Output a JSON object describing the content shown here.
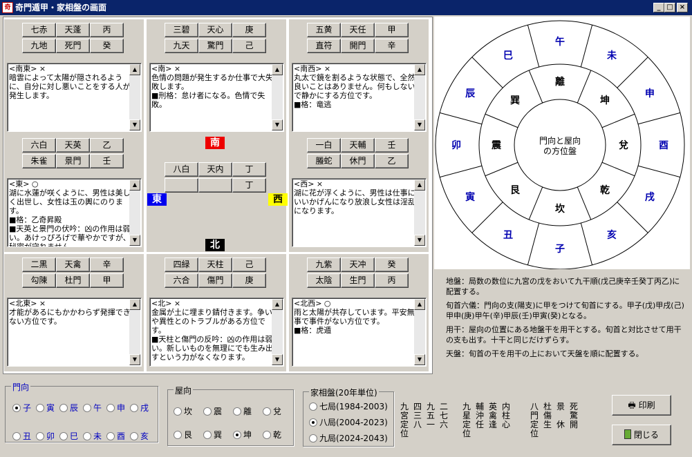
{
  "window": {
    "title": "奇門遁甲・家相盤の画面",
    "icon_text": "奇",
    "min": "_",
    "max": "□",
    "close": "×"
  },
  "cells": [
    {
      "id": "se",
      "r1": [
        "七赤",
        "天蓬",
        "丙"
      ],
      "r2": [
        "九地",
        "死門",
        "癸"
      ],
      "memo": "<南東> ×\n暗雲によって太陽が隠されるように、自分に対し悪いことをする人が発生します。"
    },
    {
      "id": "s",
      "r1": [
        "三碧",
        "天心",
        "庚"
      ],
      "r2": [
        "九天",
        "驚門",
        "己"
      ],
      "memo": "<南> ×\n色情の問題が発生するか仕事で大失敗します。\n■刑格：怠け者になる。色情で失敗。"
    },
    {
      "id": "sw",
      "r1": [
        "五黄",
        "天任",
        "甲"
      ],
      "r2": [
        "直符",
        "開門",
        "辛"
      ],
      "memo": "<南西> ×\n丸太で鏡を割るような状態で、全然良いことはありません。何もしないで静かにする方位です。\n■格：竜逃"
    },
    {
      "id": "e",
      "r1": [
        "六白",
        "天英",
        "乙"
      ],
      "r2": [
        "朱雀",
        "景門",
        "壬"
      ],
      "memo": "<東> ○\n湖に水蓮が咲くように、男性は美しく出世し、女性は玉の輿にのります。\n■格：乙奇昇殿\n■天英と景門の伏吟：凶の作用は弱い。あけっぴろげで華やかですが、秘密が守れません。"
    },
    {
      "id": "w",
      "r1": [
        "一白",
        "天輔",
        "壬"
      ],
      "r2": [
        "螣蛇",
        "休門",
        "乙"
      ],
      "memo": "<西> ×\n湖に花が浮くように、男性は仕事にいいかげんになり放浪し女性は淫乱になります。"
    },
    {
      "id": "ne",
      "r1": [
        "二黒",
        "天禽",
        "辛"
      ],
      "r2": [
        "勾陳",
        "杜門",
        "甲"
      ],
      "memo": "<北東> ×\n才能があるにもかかわらず発揮できない方位です。"
    },
    {
      "id": "n",
      "r1": [
        "四緑",
        "天柱",
        "己"
      ],
      "r2": [
        "六合",
        "傷門",
        "庚"
      ],
      "memo": "<北> ×\n金属が土に埋まり錆付きます。争いや異性とのトラブルがある方位です。\n■天柱と傷門の反吟：凶の作用は弱い。新しいものを無理にでも生み出すという力がなくなります。"
    },
    {
      "id": "nw",
      "r1": [
        "九紫",
        "天冲",
        "癸"
      ],
      "r2": [
        "太陰",
        "生門",
        "丙"
      ],
      "memo": "<北西> ○\n雨と太陽が共存しています。平安無事で事件がない方位です。\n■格：虎遁"
    }
  ],
  "center": {
    "south": "南",
    "east": "東",
    "west": "西",
    "north": "北",
    "r1": [
      "八白",
      "天内",
      "丁"
    ],
    "r2": [
      "",
      "",
      "丁"
    ]
  },
  "wheel": {
    "center_text1": "門向と屋向",
    "center_text2": "の方位盤",
    "inner": [
      "離",
      "坤",
      "兌",
      "乾",
      "坎",
      "艮",
      "震",
      "巽"
    ],
    "outer": [
      "午",
      "未",
      "申",
      "酉",
      "戌",
      "亥",
      "子",
      "丑",
      "寅",
      "卯",
      "辰",
      "巳"
    ],
    "colors": {
      "inner": "#000000",
      "outer": "#0000b0"
    }
  },
  "info": [
    "地盤：局数の数位に九宮の戊をおいて九干順(戊己庚辛壬癸丁丙乙)に配置する。",
    "旬首六儀：門向の支(陽支)に甲をつけて旬首にする。甲子(戊)甲戌(己)甲申(庚)甲午(辛)甲辰(壬)甲寅(癸)となる。",
    "用干：屋向の位置にある地盤干を用干とする。旬首と対比させて用干の支も出す。十干と同じだけずらす。",
    "天盤：旬首の干を用干の上において天盤を順に配置する。"
  ],
  "gate": {
    "title": "門向",
    "row1": [
      "子",
      "寅",
      "辰",
      "午",
      "申",
      "戌"
    ],
    "row2": [
      "丑",
      "卯",
      "巳",
      "未",
      "酉",
      "亥"
    ],
    "selected": "子"
  },
  "house": {
    "title": "屋向",
    "row1": [
      "坎",
      "震",
      "離",
      "兌"
    ],
    "row2": [
      "艮",
      "巽",
      "坤",
      "乾"
    ],
    "selected": "坤"
  },
  "kaso": {
    "title": "家相盤(20年単位)",
    "options": [
      "七局(1984-2003)",
      "八局(2004-2023)",
      "九局(2024-2043)"
    ],
    "selected": 1
  },
  "legend": {
    "g1": [
      "九宮定位",
      "四三八",
      "九五一",
      "二七六"
    ],
    "g2": [
      "九星定位",
      "輔沖任",
      "英禽逢",
      "内柱心"
    ],
    "g3": [
      "八門定位",
      "杜傷生",
      "景　休",
      "死驚開"
    ]
  },
  "buttons": {
    "print": "印刷",
    "close": "閉じる"
  }
}
